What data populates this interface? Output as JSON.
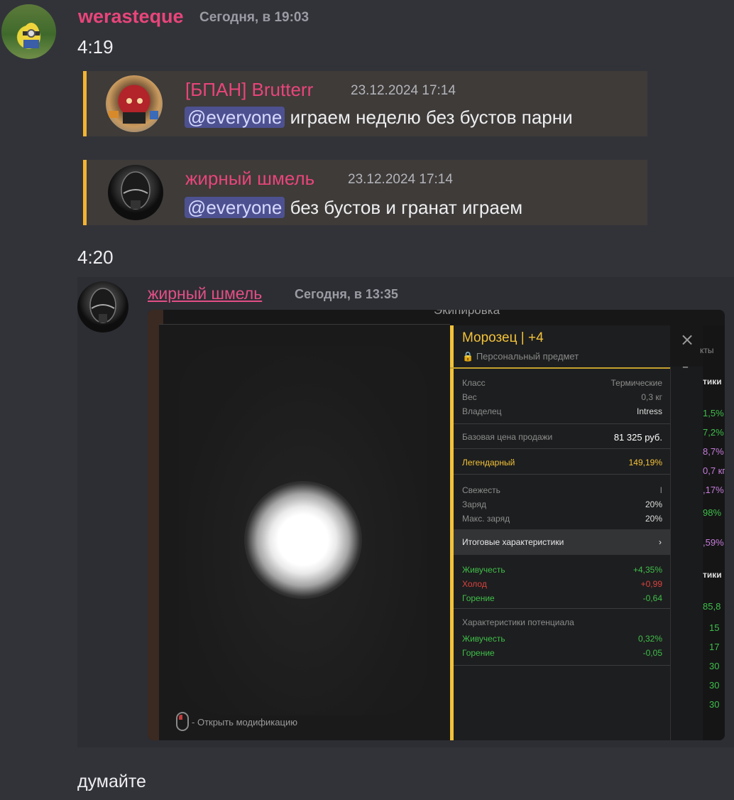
{
  "msg1": {
    "author": "werasteque",
    "timestamp": "Сегодня, в 19:03"
  },
  "time_419": "4:19",
  "quote1": {
    "author": "[БПАН] Brutterr",
    "date": "23.12.2024 17:14",
    "mention": "@everyone",
    "text": "играем неделю без бустов парни"
  },
  "quote2": {
    "author": "жирный шмель",
    "date": "23.12.2024 17:14",
    "mention": "@everyone",
    "text": "без бустов и гранат играем"
  },
  "time_420": "4:20",
  "msg2": {
    "author": "жирный шмель",
    "timestamp": "Сегодня, в 13:35"
  },
  "game": {
    "top_title": "Экипировка",
    "item_name": "Морозец | +4",
    "personal": "Персональный предмет",
    "info": [
      {
        "label": "Класс",
        "value": "Термические"
      },
      {
        "label": "Вес",
        "value": "0,3 кг"
      },
      {
        "label": "Владелец",
        "value": "Intress"
      }
    ],
    "sell_label": "Базовая цена продажи",
    "sell_value": "81 325 руб.",
    "rarity_label": "Легендарный",
    "rarity_value": "149,19%",
    "state": [
      {
        "label": "Свежесть",
        "value": "I"
      },
      {
        "label": "Заряд",
        "value": "20%"
      },
      {
        "label": "Макс. заряд",
        "value": "20%"
      }
    ],
    "final_btn": "Итоговые характеристики",
    "final_stats": [
      {
        "label": "Живучесть",
        "value": "+4,35%",
        "color": "#3fbf4a"
      },
      {
        "label": "Холод",
        "value": "+0,99",
        "color": "#d9433f"
      },
      {
        "label": "Горение",
        "value": "-0,64",
        "color": "#3fbf4a"
      }
    ],
    "potential_title": "Характеристики потенциала",
    "potential_stats": [
      {
        "label": "Живучесть",
        "value": "0,32%"
      },
      {
        "label": "Горение",
        "value": "-0,05"
      }
    ],
    "hint": "Открыть модификацию",
    "right_hdr1": "тики",
    "right_hdr2": "тики",
    "right_tab": "кты",
    "right_vals_top": [
      "1,5%",
      "7,2%",
      "8,7%",
      "0,7 кг",
      ",17%",
      "98%",
      ",59%"
    ],
    "right_vals_bottom": [
      "85,8",
      "15",
      "17",
      "30",
      "30",
      "30"
    ],
    "close": "×",
    "minus": "–",
    "chev": "›"
  },
  "last_msg": "думайте",
  "colors": {
    "username": "#e9457a",
    "quote_bar": "#f2b431",
    "gold": "#f2c23a",
    "green": "#3fbf4a",
    "red": "#d9433f"
  }
}
